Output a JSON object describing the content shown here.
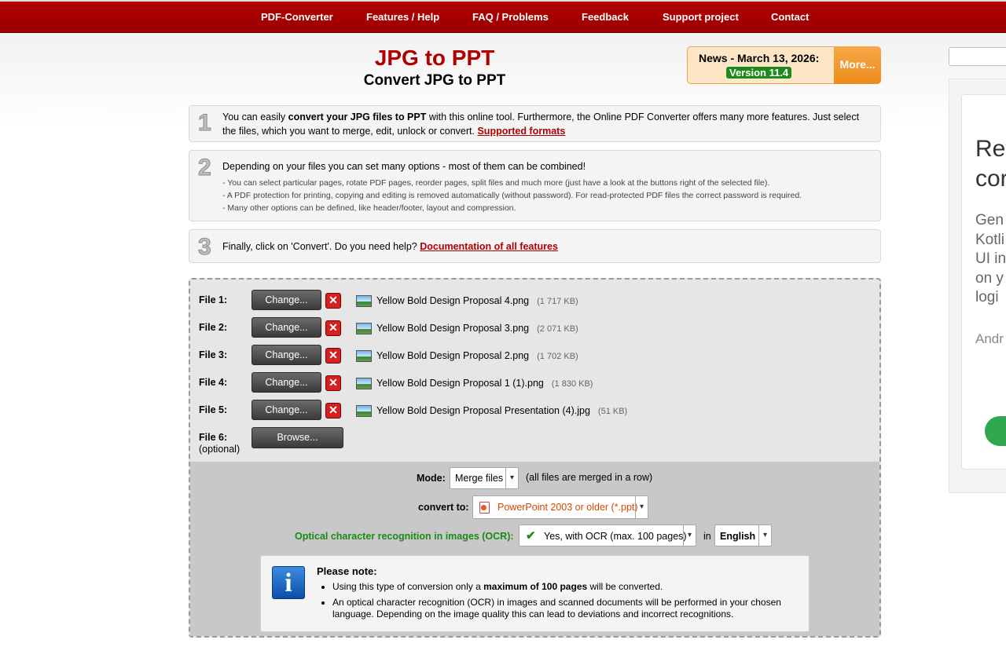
{
  "nav": [
    "PDF-Converter",
    "Features / Help",
    "FAQ / Problems",
    "Feedback",
    "Support project",
    "Contact"
  ],
  "header": {
    "title": "JPG to PPT",
    "subtitle": "Convert JPG to PPT"
  },
  "news": {
    "label": "News - March 13, 2026:",
    "version": "Version 11.4",
    "more": "More..."
  },
  "steps": {
    "one": {
      "num": "1",
      "pre": "You can easily ",
      "bold": "convert your JPG files to PPT",
      "post": " with this online tool. Furthermore, the Online PDF Converter offers many more features. Just select the files, which you want to merge, edit, unlock or convert. ",
      "link": "Supported formats"
    },
    "two": {
      "num": "2",
      "main": "Depending on your files you can set many options - most of them can be combined!",
      "bullets": [
        "- You can select particular pages, rotate PDF pages, reorder pages, split files and much more (just have a look at the buttons right of the selected file).",
        "- A PDF protection for printing, copying and editing is removed automatically (without password). For read-protected PDF files the correct password is required.",
        "- Many other options can be defined, like header/footer, layout and compression."
      ]
    },
    "three": {
      "num": "3",
      "text": "Finally, click on 'Convert'. Do you need help? ",
      "link": "Documentation of all features"
    }
  },
  "files": [
    {
      "label": "File 1:",
      "button": "Change...",
      "name": "Yellow Bold Design Proposal 4.png",
      "size": "(1 717 KB)"
    },
    {
      "label": "File 2:",
      "button": "Change...",
      "name": "Yellow Bold Design Proposal 3.png",
      "size": "(2 071 KB)"
    },
    {
      "label": "File 3:",
      "button": "Change...",
      "name": "Yellow Bold Design Proposal 2.png",
      "size": "(1 702 KB)"
    },
    {
      "label": "File 4:",
      "button": "Change...",
      "name": "Yellow Bold Design Proposal 1 (1).png",
      "size": "(1 830 KB)"
    },
    {
      "label": "File 5:",
      "button": "Change...",
      "name": "Yellow Bold Design Proposal Presentation (4).jpg",
      "size": "(51 KB)"
    }
  ],
  "file6": {
    "label": "File 6:",
    "optional": "(optional)",
    "button": "Browse..."
  },
  "remove_glyph": "✕",
  "options": {
    "mode_label": "Mode:",
    "mode_value": "Merge files",
    "mode_hint": "(all files are merged in a row)",
    "convert_label": "convert to:",
    "convert_value": "PowerPoint 2003 or older (*.ppt)",
    "ocr_label": "Optical character recognition in images (OCR):",
    "ocr_value": "Yes, with OCR (max. 100 pages)",
    "in_label": "in",
    "lang_value": "English"
  },
  "note": {
    "icon": "i",
    "head": "Please note:",
    "b1_pre": "Using this type of conversion only a ",
    "b1_bold": "maximum of 100 pages",
    "b1_post": " will be converted.",
    "b2": "An optical character recognition (OCR) in images and scanned documents will be performed in your chosen language. Depending on the image quality this can lead to deviations and incorrect recognitions."
  },
  "ad": {
    "title_l1": "Ref",
    "title_l2": "cor",
    "body": [
      "Gen",
      "Kotli",
      "UI in",
      "on y",
      "logi"
    ],
    "footer": "Andr"
  },
  "colors": {
    "nav_bg": "#9a0000",
    "accent_red": "#b00000",
    "ocr_green": "#1a8a1a",
    "convert_orange": "#d04a00",
    "version_green": "#1e8a1e"
  }
}
